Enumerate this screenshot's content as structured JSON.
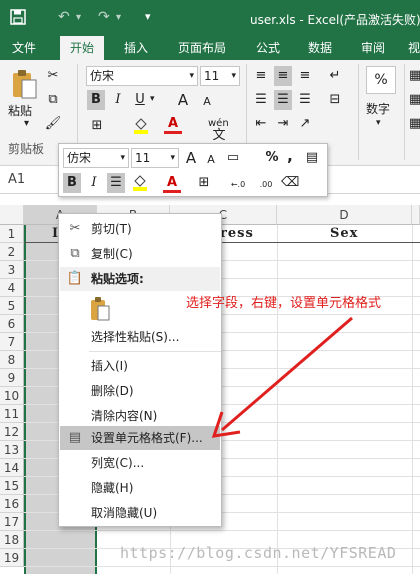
{
  "window": {
    "title": "user.xls - Excel(产品激活失败)"
  },
  "quick_access": {
    "save_icon": "save-icon",
    "undo_icon": "undo-icon",
    "redo_icon": "redo-icon",
    "customize_icon": "customize-icon"
  },
  "tabs": [
    "文件",
    "开始",
    "插入",
    "页面布局",
    "公式",
    "数据",
    "审阅",
    "视"
  ],
  "ribbon": {
    "paste_label": "粘贴",
    "clipboard_group": "剪贴板",
    "font_name": "仿宋",
    "font_size": "11",
    "wen_label": "wén",
    "wen_char": "文",
    "number_label": "数字",
    "percent_symbol": "%",
    "bold": "B",
    "italic": "I",
    "underline": "U",
    "grow_font": "A",
    "shrink_font": "A",
    "font_color_glyph": "A"
  },
  "name_box": {
    "value": "A1"
  },
  "mini_toolbar": {
    "font_name": "仿宋",
    "font_size": "11",
    "bold": "B",
    "italic": "I",
    "percent": "%",
    "comma": ",",
    "inc_decimal": "←.0",
    "dec_decimal": ".00",
    "font_color_glyph": "A",
    "grow_font": "A",
    "shrink_font": "A"
  },
  "grid": {
    "columns": [
      "A",
      "B",
      "C",
      "D"
    ],
    "rows": [
      "1",
      "2",
      "3",
      "4",
      "5",
      "6",
      "7",
      "8",
      "9",
      "10",
      "11",
      "12",
      "13",
      "14",
      "15",
      "16",
      "17",
      "18",
      "19"
    ],
    "cells": {
      "a1": "I",
      "c1": "ress",
      "d1": "Sex"
    }
  },
  "context_menu": {
    "items": [
      {
        "label": "剪切(T)",
        "icon": "scissors-icon"
      },
      {
        "label": "复制(C)",
        "icon": "copy-icon"
      },
      {
        "label": "粘贴选项:",
        "icon": "paste-icon"
      },
      {
        "label": "",
        "icon": "paste-icon"
      },
      {
        "label": "选择性粘贴(S)...",
        "icon": ""
      },
      {
        "label": "插入(I)",
        "icon": ""
      },
      {
        "label": "删除(D)",
        "icon": ""
      },
      {
        "label": "清除内容(N)",
        "icon": ""
      },
      {
        "label": "设置单元格格式(F)...",
        "icon": "format-cells-icon"
      },
      {
        "label": "列宽(C)...",
        "icon": ""
      },
      {
        "label": "隐藏(H)",
        "icon": ""
      },
      {
        "label": "取消隐藏(U)",
        "icon": ""
      }
    ]
  },
  "annotation": {
    "text": "选择字段，右键，设置单元格格式"
  },
  "watermark": {
    "text": "https://blog.csdn.net/YFSREAD"
  },
  "colors": {
    "excel_green": "#217346",
    "annotation_red": "#e0201e",
    "selected_column": "#d2d2d2"
  }
}
